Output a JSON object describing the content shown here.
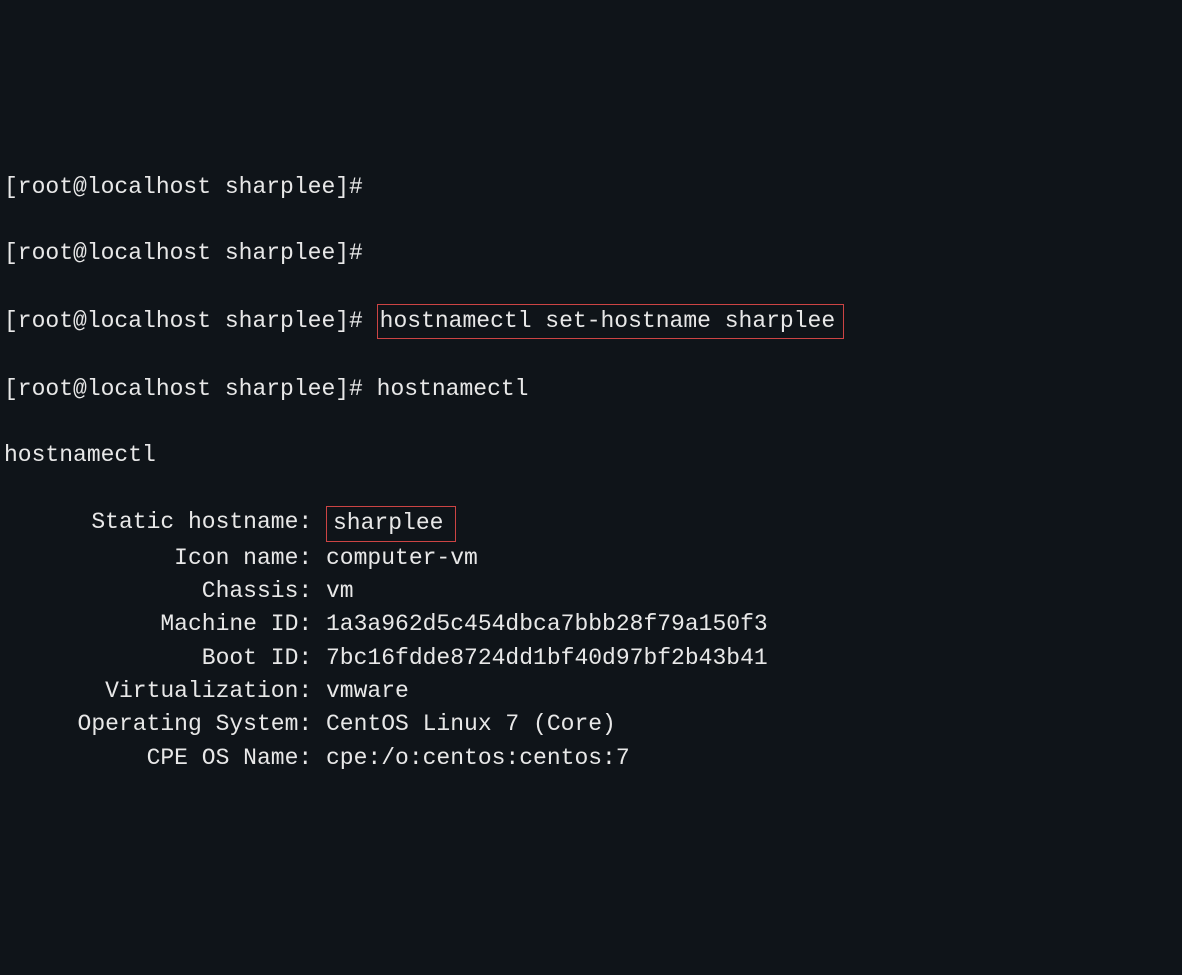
{
  "prompt": "[root@localhost sharplee]# ",
  "lines": {
    "l1": "[root@localhost sharplee]#",
    "l2": "[root@localhost sharplee]#",
    "l3_prompt": "[root@localhost sharplee]# ",
    "l3_cmd": "hostnamectl set-hostname sharplee",
    "l4": "[root@localhost sharplee]# hostnamectl",
    "l5": "hostnamectl"
  },
  "kv": [
    {
      "key": "Static hostname: ",
      "val": "sharplee",
      "boxed": true
    },
    {
      "key": "Icon name: ",
      "val": "computer-vm",
      "boxed": false
    },
    {
      "key": "Chassis: ",
      "val": "vm",
      "boxed": false
    },
    {
      "key": "Machine ID: ",
      "val": "1a3a962d5c454dbca7bbb28f79a150f3",
      "boxed": false
    },
    {
      "key": "Boot ID: ",
      "val": "7bc16fdde8724dd1bf40d97bf2b43b41",
      "boxed": false
    },
    {
      "key": "Virtualization: ",
      "val": "vmware",
      "boxed": false
    },
    {
      "key": "Operating System: ",
      "val": "CentOS Linux 7 (Core)",
      "boxed": false
    },
    {
      "key": "CPE OS Name: ",
      "val": "cpe:/o:centos:centos:7",
      "boxed": false
    }
  ]
}
